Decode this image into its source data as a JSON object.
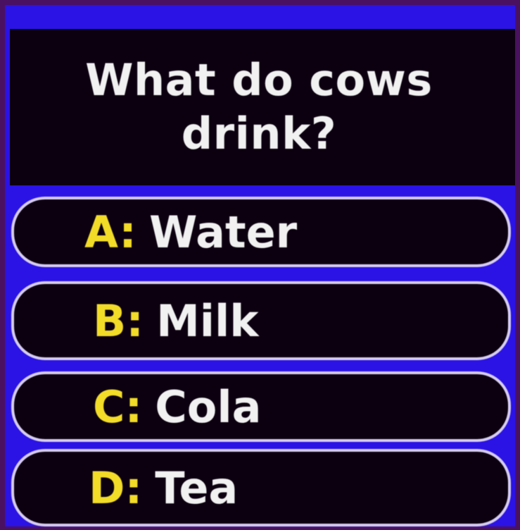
{
  "question": "What do cows drink?",
  "answers": [
    {
      "letter": "A:",
      "text": "Water"
    },
    {
      "letter": "B:",
      "text": "Milk"
    },
    {
      "letter": "C:",
      "text": "Cola"
    },
    {
      "letter": "D:",
      "text": "Tea"
    }
  ],
  "colors": {
    "frame": "#4a1160",
    "panel": "#2b13e6",
    "box": "#0c0010",
    "border": "#d6cdf0",
    "letter": "#f2dc28",
    "text": "#f1f1f1"
  }
}
